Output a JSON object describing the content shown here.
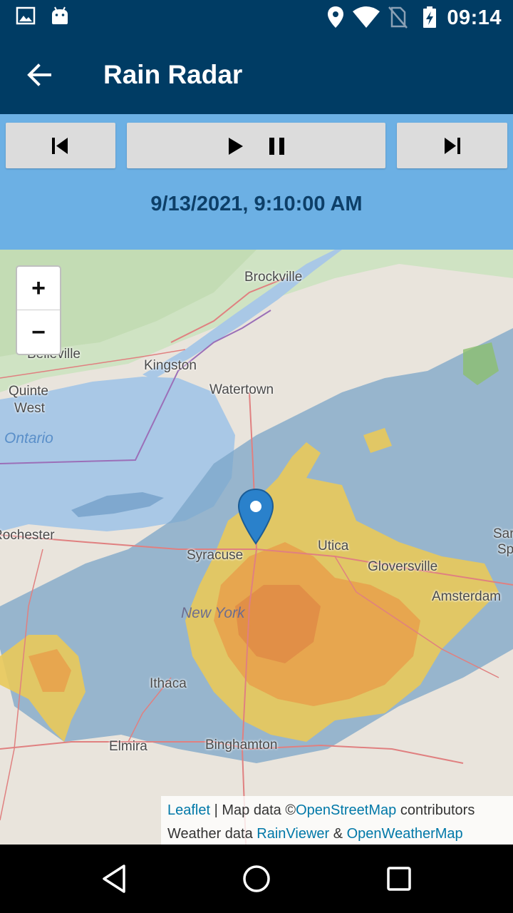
{
  "status_bar": {
    "time": "09:14",
    "icons": [
      "image-icon",
      "android-icon",
      "location-icon",
      "wifi-icon",
      "no-sim-icon",
      "battery-charging-icon"
    ]
  },
  "app_bar": {
    "title": "Rain Radar",
    "back_icon": "arrow-back-icon"
  },
  "controls": {
    "previous_icon": "skip-previous-icon",
    "play_icon": "play-icon",
    "pause_icon": "pause-icon",
    "next_icon": "skip-next-icon",
    "timestamp": "9/13/2021, 9:10:00 AM"
  },
  "map": {
    "zoom_in_label": "+",
    "zoom_out_label": "−",
    "places": [
      "Brockville",
      "Belleville",
      "Kingston",
      "Quinte",
      "West",
      "Watertown",
      "Ontario",
      "Rochester",
      "Syracuse",
      "Utica",
      "Gloversville",
      "Amsterdam",
      "New York",
      "Ithaca",
      "Elmira",
      "Binghamton",
      "Sar",
      "Sp"
    ],
    "attribution": {
      "leaflet": "Leaflet",
      "separator": " | Map data ©",
      "osm": "OpenStreetMap",
      "contributors": " contributors",
      "weather_prefix": "Weather data ",
      "rainviewer": "RainViewer",
      "amp": " & ",
      "owm": "OpenWeatherMap"
    }
  },
  "nav_bar": {
    "icons": [
      "back-triangle-icon",
      "home-circle-icon",
      "recents-square-icon"
    ]
  },
  "colors": {
    "app_bar": "#003c64",
    "controls_bg": "#6cb0e4",
    "timestamp_text": "#0d3f68",
    "marker": "#2a81cb"
  }
}
